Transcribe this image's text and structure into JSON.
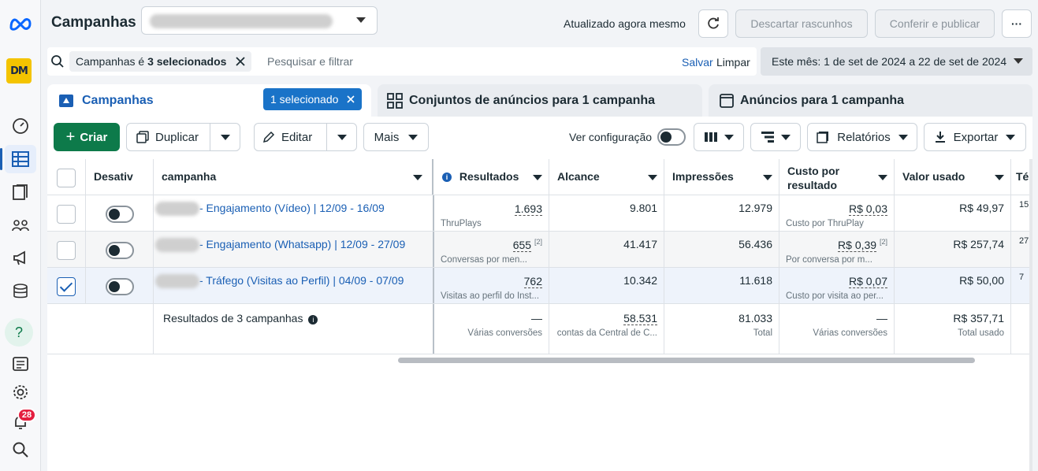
{
  "app": {
    "title": "Campanhas",
    "updated": "Atualizado agora mesmo",
    "discard": "Descartar rascunhos",
    "publish": "Conferir e publicar",
    "more": "···"
  },
  "rail": {
    "logo_text": "DM",
    "notifications": "28"
  },
  "filter": {
    "chip_prefix": "Campanhas é",
    "chip_value": "3 selecionados",
    "placeholder": "Pesquisar e filtrar",
    "save": "Salvar",
    "clear": "Limpar",
    "date_range": "Este mês: 1 de set de 2024 a 22 de set de 2024"
  },
  "tabs": {
    "campaigns": "Campanhas",
    "selected": "1 selecionado",
    "adsets": "Conjuntos de anúncios para 1 campanha",
    "ads": "Anúncios para 1 campanha"
  },
  "toolbar": {
    "create": "Criar",
    "duplicate": "Duplicar",
    "edit": "Editar",
    "more": "Mais",
    "view_config": "Ver configuração",
    "reports": "Relatórios",
    "export": "Exportar"
  },
  "columns": {
    "off": "Desativ",
    "campaign": "campanha",
    "results": "Resultados",
    "reach": "Alcance",
    "impressions": "Impressões",
    "cost_line1": "Custo por",
    "cost_line2": "resultado",
    "spent": "Valor usado",
    "next": "Té"
  },
  "rows": [
    {
      "name": "- Engajamento (Vídeo) | 12/09 - 16/09",
      "results": "1.693",
      "results_note": "",
      "results_sub": "ThruPlays",
      "reach": "9.801",
      "impressions": "12.979",
      "cost": "R$ 0,03",
      "cost_note": "",
      "cost_sub": "Custo por ThruPlay",
      "spent": "R$ 49,97",
      "next": "15",
      "checked": false
    },
    {
      "name": "- Engajamento (Whatsapp) | 12/09 - 27/09",
      "results": "655",
      "results_note": "[2]",
      "results_sub": "Conversas por men...",
      "reach": "41.417",
      "impressions": "56.436",
      "cost": "R$ 0,39",
      "cost_note": "[2]",
      "cost_sub": "Por conversa por m...",
      "spent": "R$ 257,74",
      "next": "27",
      "checked": false
    },
    {
      "name": "- Tráfego (Visitas ao Perfil) | 04/09 - 07/09",
      "results": "762",
      "results_note": "",
      "results_sub": "Visitas ao perfil do Inst...",
      "reach": "10.342",
      "impressions": "11.618",
      "cost": "R$ 0,07",
      "cost_note": "",
      "cost_sub": "Custo por visita ao per...",
      "spent": "R$ 50,00",
      "next": "7",
      "checked": true
    }
  ],
  "totals": {
    "label": "Resultados de 3 campanhas",
    "results": "—",
    "results_sub": "Várias conversões",
    "reach": "58.531",
    "reach_sub": "contas da Central de C...",
    "impressions": "81.033",
    "impressions_sub": "Total",
    "cost": "—",
    "cost_sub": "Várias conversões",
    "spent": "R$ 357,71",
    "spent_sub": "Total usado"
  },
  "colors": {
    "accent": "#1a5fb4",
    "create_green": "#0d7a4a",
    "badge_red": "#e41e3f"
  }
}
